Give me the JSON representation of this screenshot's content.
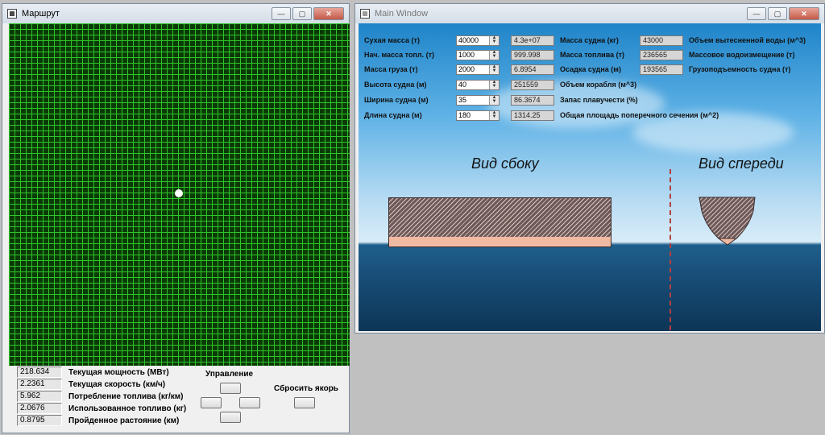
{
  "route_window": {
    "title": "Маршрут",
    "stats": [
      {
        "value": "218.634",
        "label": "Текущая мощность (МВт)"
      },
      {
        "value": "2.2361",
        "label": "Текущая скорость (км/ч)"
      },
      {
        "value": "5.962",
        "label": "Потребление топлива (кг/км)"
      },
      {
        "value": "2.0676",
        "label": "Использованное топливо (кг)"
      },
      {
        "value": "0.8795",
        "label": "Пройденное растояние (км)"
      }
    ],
    "control_label": "Управление",
    "anchor_label": "Сбросить якорь"
  },
  "main_window": {
    "title": "Main Window",
    "inputs": [
      {
        "label": "Сухая масса (т)",
        "value": "40000",
        "result": "4.3e+07"
      },
      {
        "label": "Нач. масса топл. (т)",
        "value": "1000",
        "result": "999.998"
      },
      {
        "label": "Масса груза (т)",
        "value": "2000",
        "result": "6.8954"
      },
      {
        "label": "Высота судна (м)",
        "value": "40",
        "result": "251559"
      },
      {
        "label": "Ширина судна (м)",
        "value": "35",
        "result": "86.3674"
      },
      {
        "label": "Длина судна (м)",
        "value": "180",
        "result": "1314.25"
      }
    ],
    "mid_labels": [
      "Масса судна (кг)",
      "Масса топлива (т)",
      "Осадка судна (м)",
      "Объем корабля (м^3)",
      "Запас плавучести (%)",
      "Общая площадь поперечного сечения (м^2)"
    ],
    "right_fields": [
      {
        "value": "43000",
        "label": "Объем вытесненной воды (м^3)"
      },
      {
        "value": "236565",
        "label": "Массовое водоизмещение (т)"
      },
      {
        "value": "193565",
        "label": "Грузоподъемность судна (т)"
      }
    ],
    "side_view_title": "Вид сбоку",
    "front_view_title": "Вид спереди"
  },
  "colors": {
    "grid_bg": "#0b3a06",
    "grid_line": "#2dc52a",
    "hull_dark": "#6f5858",
    "hull_underwater": "#f0b9a2",
    "axis_dash": "#b34040"
  }
}
